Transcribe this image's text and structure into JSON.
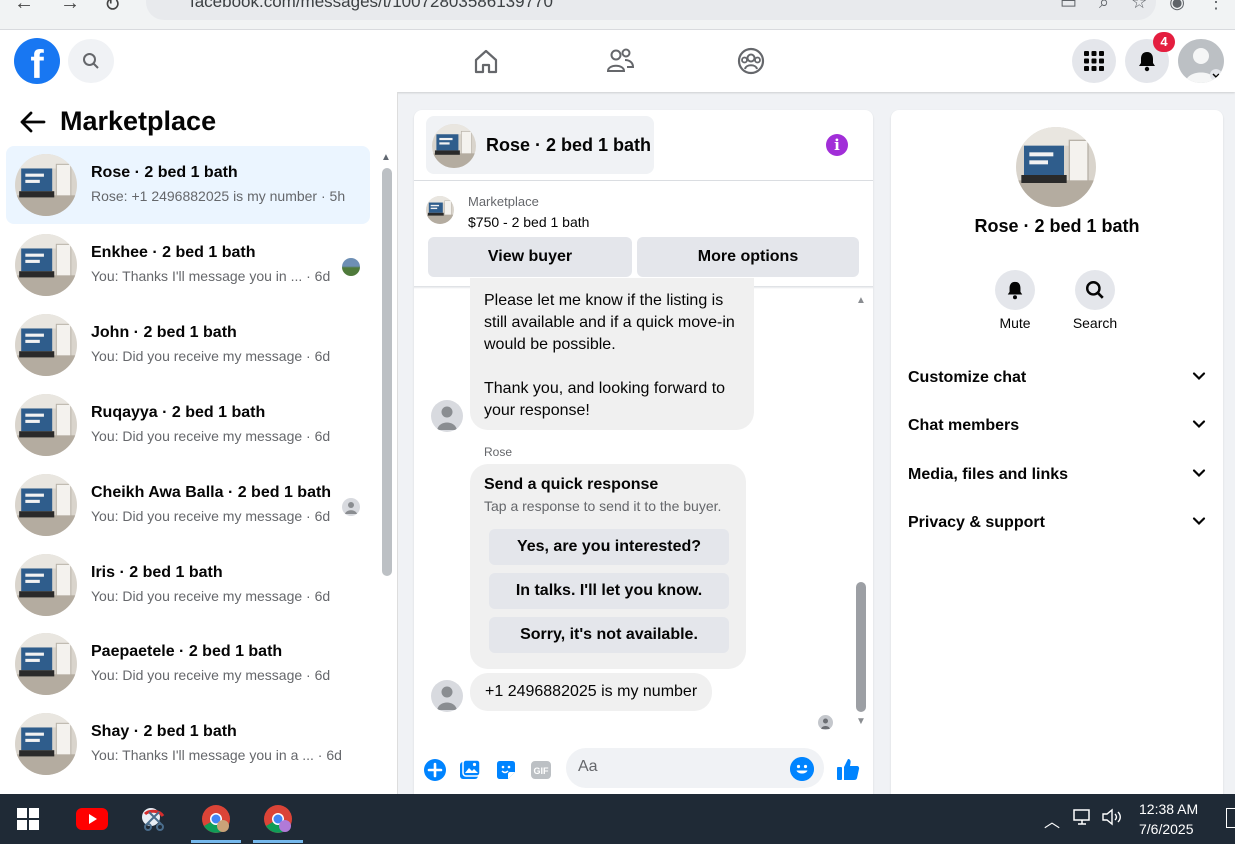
{
  "browser": {
    "url": "facebook.com/messages/t/10072803586139770"
  },
  "header": {
    "notification_count": "4"
  },
  "left_panel": {
    "title": "Marketplace",
    "conversations": [
      {
        "title": "Rose · 2 bed 1 bath",
        "subtitle": "Rose: +1 2496882025 is my number · 5h",
        "active": true
      },
      {
        "title": "Enkhee · 2 bed 1 bath",
        "subtitle": "You: Thanks I'll message you in ...  · 6d"
      },
      {
        "title": "John · 2 bed 1 bath",
        "subtitle": "You: Did you receive my message · 6d"
      },
      {
        "title": "Ruqayya · 2 bed 1 bath",
        "subtitle": "You: Did you receive my message · 6d"
      },
      {
        "title": "Cheikh Awa Balla · 2 bed 1 bath",
        "subtitle": "You: Did you receive my message · 6d"
      },
      {
        "title": "Iris · 2 bed 1 bath",
        "subtitle": "You: Did you receive my message · 6d"
      },
      {
        "title": "Paepaetele · 2 bed 1 bath",
        "subtitle": "You: Did you receive my message · 6d"
      },
      {
        "title": "Shay · 2 bed 1 bath",
        "subtitle": "You: Thanks I'll message you in a ...  · 6d"
      }
    ]
  },
  "chat": {
    "title": "Rose · 2 bed 1 bath",
    "listing_label": "Marketplace",
    "listing_price": "$750 - 2 bed 1 bath",
    "view_buyer_label": "View buyer",
    "more_options_label": "More options",
    "message_1_line_1": "Please let me know if the listing is still available and if a quick move-in would be possible.",
    "message_1_line_2": "Thank you, and looking forward to your response!",
    "sender_name": "Rose",
    "quick_response_title": "Send a quick response",
    "quick_response_subtitle": "Tap a response to send it to the buyer.",
    "quick_responses": [
      "Yes, are you interested?",
      "In talks. I'll let you know.",
      "Sorry, it's not available."
    ],
    "last_message": "+1 2496882025 is my number",
    "composer_placeholder": "Aa"
  },
  "right_panel": {
    "name": "Rose · 2 bed 1 bath",
    "mute_label": "Mute",
    "search_label": "Search",
    "sections": [
      "Customize chat",
      "Chat members",
      "Media, files and links",
      "Privacy & support"
    ]
  },
  "taskbar": {
    "time": "12:38 AM",
    "date": "7/6/2025"
  },
  "colors": {
    "facebook_blue": "#1877f2",
    "messenger_blue": "#0084ff",
    "info_purple": "#a12ed8",
    "badge_red": "#e41e3f",
    "active_row": "#ebf5ff"
  }
}
